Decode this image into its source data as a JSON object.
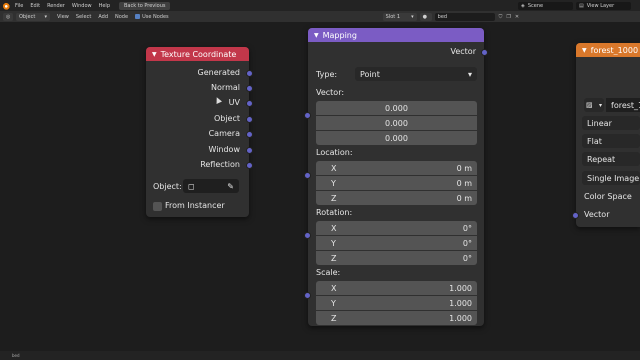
{
  "topbar": {
    "menus": [
      "File",
      "Edit",
      "Render",
      "Window",
      "Help"
    ],
    "back_button": "Back to Previous",
    "scene": "Scene",
    "view_layer": "View Layer"
  },
  "header": {
    "mode": "Object",
    "menus": [
      "View",
      "Select",
      "Add",
      "Node"
    ],
    "use_nodes_label": "Use Nodes",
    "use_nodes_checked": true,
    "slot": "Slot 1",
    "material": "bed"
  },
  "texture_coordinate": {
    "title": "Texture Coordinate",
    "color": "#c2374a",
    "outputs": [
      "Generated",
      "Normal",
      "UV",
      "Object",
      "Camera",
      "Window",
      "Reflection"
    ],
    "object_label": "Object:",
    "from_instancer_label": "From Instancer"
  },
  "mapping": {
    "title": "Mapping",
    "color": "#7b5cc4",
    "output": "Vector",
    "type_label": "Type:",
    "type_value": "Point",
    "vector_label": "Vector:",
    "vector_values": [
      "0.000",
      "0.000",
      "0.000"
    ],
    "location_label": "Location:",
    "location": [
      {
        "axis": "X",
        "value": "0 m"
      },
      {
        "axis": "Y",
        "value": "0 m"
      },
      {
        "axis": "Z",
        "value": "0 m"
      }
    ],
    "rotation_label": "Rotation:",
    "rotation": [
      {
        "axis": "X",
        "value": "0°"
      },
      {
        "axis": "Y",
        "value": "0°"
      },
      {
        "axis": "Z",
        "value": "0°"
      }
    ],
    "scale_label": "Scale:",
    "scale": [
      {
        "axis": "X",
        "value": "1.000"
      },
      {
        "axis": "Y",
        "value": "1.000"
      },
      {
        "axis": "Z",
        "value": "1.000"
      }
    ]
  },
  "image_texture": {
    "title": "forest_1000",
    "color": "#d9782b",
    "image_name": "forest_1",
    "interpolation": "Linear",
    "projection": "Flat",
    "extension": "Repeat",
    "source": "Single Image",
    "color_space_label": "Color Space",
    "vector_label": "Vector"
  },
  "status": {
    "left": "bed"
  }
}
